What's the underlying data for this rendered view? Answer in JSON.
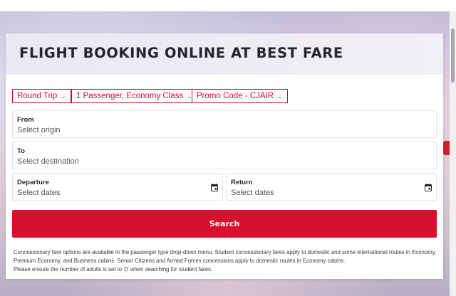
{
  "page": {
    "title": "FLIGHT BOOKING ONLINE AT BEST FARE"
  },
  "dropdowns": {
    "trip_type": "Round Trip",
    "passengers": "1 Passenger, Economy Class",
    "promo": "Promo Code - CJAIR"
  },
  "fields": {
    "from_label": "From",
    "from_placeholder": "Select origin",
    "to_label": "To",
    "to_placeholder": "Select destination",
    "departure_label": "Departure",
    "departure_placeholder": "Select dates",
    "return_label": "Return",
    "return_placeholder": "Select dates"
  },
  "search_label": "Search",
  "notes": {
    "line1": "Concessionary fare options are available in the passenger type drop-down menu. Student concessionary fares apply to domestic and some international routes in Economy, Premium Economy, and Business cabins. Senior Citizens and Armed Forces concessions apply to domestic routes in Economy cabins.",
    "line2": "Please ensure the number of adults is set to '0' when searching for student fares."
  },
  "icons": {
    "chevron": "chevron-down-icon",
    "calendar": "calendar-icon"
  },
  "colors": {
    "accent": "#d80f2d",
    "title_text": "#24262d"
  }
}
